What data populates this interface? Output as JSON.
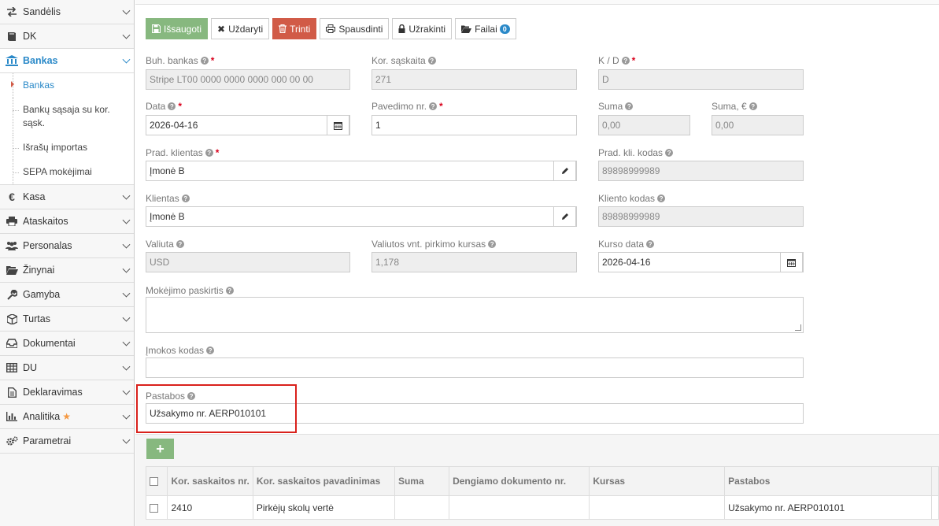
{
  "sidebar": {
    "items": [
      {
        "label": "Sandėlis",
        "icon": "exchange-icon"
      },
      {
        "label": "DK",
        "icon": "book-icon"
      },
      {
        "label": "Bankas",
        "icon": "bank-icon"
      },
      {
        "label": "Kasa",
        "icon": "euro-icon"
      },
      {
        "label": "Ataskaitos",
        "icon": "print-icon"
      },
      {
        "label": "Personalas",
        "icon": "users-icon"
      },
      {
        "label": "Žinynai",
        "icon": "folder-icon"
      },
      {
        "label": "Gamyba",
        "icon": "wrench-icon"
      },
      {
        "label": "Turtas",
        "icon": "cube-icon"
      },
      {
        "label": "Dokumentai",
        "icon": "inbox-icon"
      },
      {
        "label": "DU",
        "icon": "table-icon"
      },
      {
        "label": "Deklaravimas",
        "icon": "file-icon"
      },
      {
        "label": "Analitika",
        "icon": "bar-chart-icon"
      },
      {
        "label": "Parametrai",
        "icon": "cogs-icon"
      }
    ],
    "submenu": [
      {
        "label": "Bankas"
      },
      {
        "label": "Bankų sąsaja su kor. sąsk."
      },
      {
        "label": "Išrašų importas"
      },
      {
        "label": "SEPA mokėjimai"
      }
    ],
    "analitika_star": "★",
    "active_color": "#2a89c8"
  },
  "toolbar": {
    "save": "Išsaugoti",
    "close": "Uždaryti",
    "delete": "Trinti",
    "print": "Spausdinti",
    "lock": "Užrakinti",
    "files": "Failai",
    "files_count": "0",
    "save_color": "#87b87f",
    "delete_color": "#d15b47"
  },
  "form": {
    "buh_bankas": {
      "label": "Buh. bankas",
      "value": "Stripe LT00 0000 0000 0000 000 00 00"
    },
    "kor_saskaita": {
      "label": "Kor. sąskaita",
      "value": "271"
    },
    "kd": {
      "label": "K / D",
      "value": "D"
    },
    "data": {
      "label": "Data",
      "value": "2026-04-16"
    },
    "pavedimo_nr": {
      "label": "Pavedimo nr.",
      "value": "1"
    },
    "suma": {
      "label": "Suma",
      "value": "0,00"
    },
    "suma_eur": {
      "label": "Suma, €",
      "value": "0,00"
    },
    "prad_klientas": {
      "label": "Prad. klientas",
      "value": "Įmonė B"
    },
    "prad_kli_kodas": {
      "label": "Prad. kli. kodas",
      "value": "89898999989"
    },
    "klientas": {
      "label": "Klientas",
      "value": "Įmonė B"
    },
    "kliento_kodas": {
      "label": "Kliento kodas",
      "value": "89898999989"
    },
    "valiuta": {
      "label": "Valiuta",
      "value": "USD"
    },
    "valiutos_kursas": {
      "label": "Valiutos vnt. pirkimo kursas",
      "value": "1,178"
    },
    "kurso_data": {
      "label": "Kurso data",
      "value": "2026-04-16"
    },
    "mokejimo_paskirtis": {
      "label": "Mokėjimo paskirtis",
      "value": ""
    },
    "imokos_kodas": {
      "label": "Įmokos kodas",
      "value": ""
    },
    "pastabos": {
      "label": "Pastabos",
      "value": "Užsakymo nr. AERP010101"
    }
  },
  "table": {
    "add_label": "+",
    "headers": [
      "Kor. saskaitos nr.",
      "Kor. saskaitos pavadinimas",
      "Suma",
      "Dengiamo dokumento nr.",
      "Kursas",
      "Pastabos"
    ],
    "rows": [
      {
        "kor_nr": "2410",
        "pavadinimas": "Pirkėjų skolų vertė",
        "suma": "",
        "dok_nr": "",
        "kursas": "",
        "pastabos": "Užsakymo nr. AERP010101"
      }
    ]
  },
  "highlight_color": "#d9211c"
}
